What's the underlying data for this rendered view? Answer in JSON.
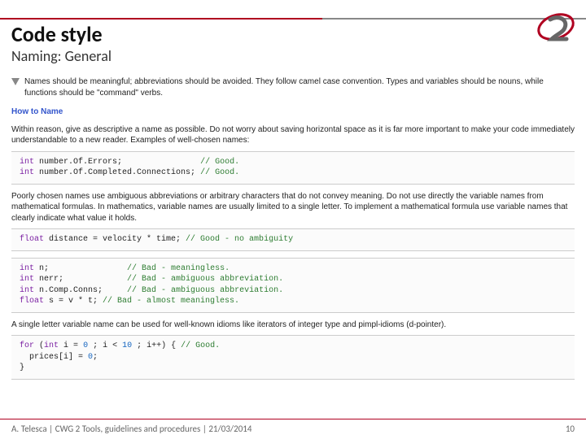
{
  "header": {
    "title": "Code style",
    "subtitle": "Naming: General"
  },
  "body": {
    "callout": "Names should be meaningful; abbreviations should be avoided. They follow camel case convention. Types and variables should be nouns, while functions should be \"command\" verbs.",
    "section_head": "How to Name",
    "para1": "Within reason, give as descriptive a name as possible. Do not worry about saving horizontal space as it is far more important to make your code immediately understandable to a new reader. Examples of well-chosen names:",
    "code1": {
      "l1a": "int",
      "l1b": " number.Of.Errors;                ",
      "l1c": "// Good.",
      "l2a": "int",
      "l2b": " number.Of.Completed.Connections; ",
      "l2c": "// Good."
    },
    "para2": "Poorly chosen names use ambiguous abbreviations or arbitrary characters that do not convey meaning. Do not use directly the variable names from mathematical formulas. In mathematics, variable names are usually limited to a single letter. To implement a mathematical formula use variable names that clearly indicate what value it holds.",
    "code2": {
      "l1a": "float",
      "l1b": " distance = velocity * time; ",
      "l1c": "// Good - no ambiguity"
    },
    "code3": {
      "l1a": "int",
      "l1b": " n;                ",
      "l1c": "// Bad - meaningless.",
      "l2a": "int",
      "l2b": " nerr;             ",
      "l2c": "// Bad - ambiguous abbreviation.",
      "l3a": "int",
      "l3b": " n.Comp.Conns;     ",
      "l3c": "// Bad - ambiguous abbreviation.",
      "l4a": "float",
      "l4b": " s = v * t; ",
      "l4c": "// Bad - almost meaningless."
    },
    "para3": "A single letter variable name can be used for well-known idioms like iterators of integer type and pimpl-idioms (d-pointer).",
    "code4": {
      "l1a": "for",
      "l1b": " (",
      "l1c": "int",
      "l1d": " i = ",
      "l1e": "0",
      "l1f": " ; i < ",
      "l1g": "10",
      "l1h": " ; i++) { ",
      "l1i": "// Good.",
      "l2a": "  prices[i] = ",
      "l2b": "0",
      "l2c": ";",
      "l3a": "}"
    }
  },
  "footer": {
    "left": "A. Telesca | CWG 2 Tools, guidelines and procedures | 21/03/2014",
    "page": "10"
  }
}
